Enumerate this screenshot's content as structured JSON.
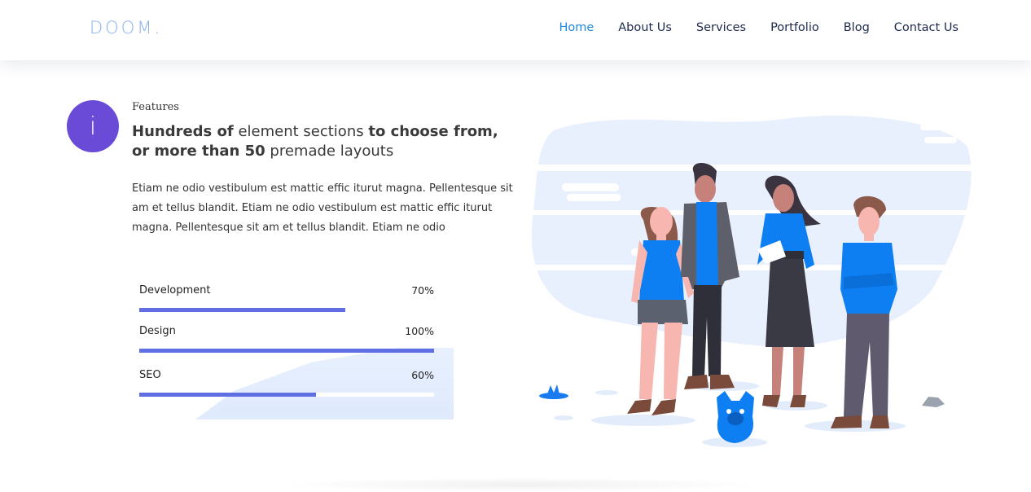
{
  "brand": {
    "logo_text": "DOOM",
    "logo_dot": "."
  },
  "nav": {
    "items": [
      {
        "label": "Home",
        "active": true
      },
      {
        "label": "About Us"
      },
      {
        "label": "Services"
      },
      {
        "label": "Portfolio"
      },
      {
        "label": "Blog"
      },
      {
        "label": "Contact Us"
      }
    ]
  },
  "feature": {
    "icon_glyph": "i",
    "label": "Features",
    "headline_p1": "Hundreds of",
    "headline_p2": " element sections ",
    "headline_p3": "to choose from,",
    "headline_p4": "or more than 50",
    "headline_p5": " premade layouts",
    "description": "Etiam ne odio vestibulum est mattic effic iturut magna. Pellentesque sit am et tellus blandit. Etiam ne odio vestibulum est mattic effic iturut magna. Pellentesque sit am et tellus blandit. Etiam ne odio"
  },
  "skills": [
    {
      "name": "Development",
      "percent_label": "70%",
      "value": 0.7
    },
    {
      "name": "Design",
      "percent_label": "100%",
      "value": 1.0
    },
    {
      "name": "SEO",
      "percent_label": "60%",
      "value": 0.6
    }
  ],
  "colors": {
    "accent": "#1e88e5",
    "nav_text": "#1d2a4d",
    "icon_bg": "#6a4bd8",
    "progress": "#5f6fe3",
    "illustration_blob": "#e8f0fd",
    "shirt_blue": "#0d7ff2"
  }
}
